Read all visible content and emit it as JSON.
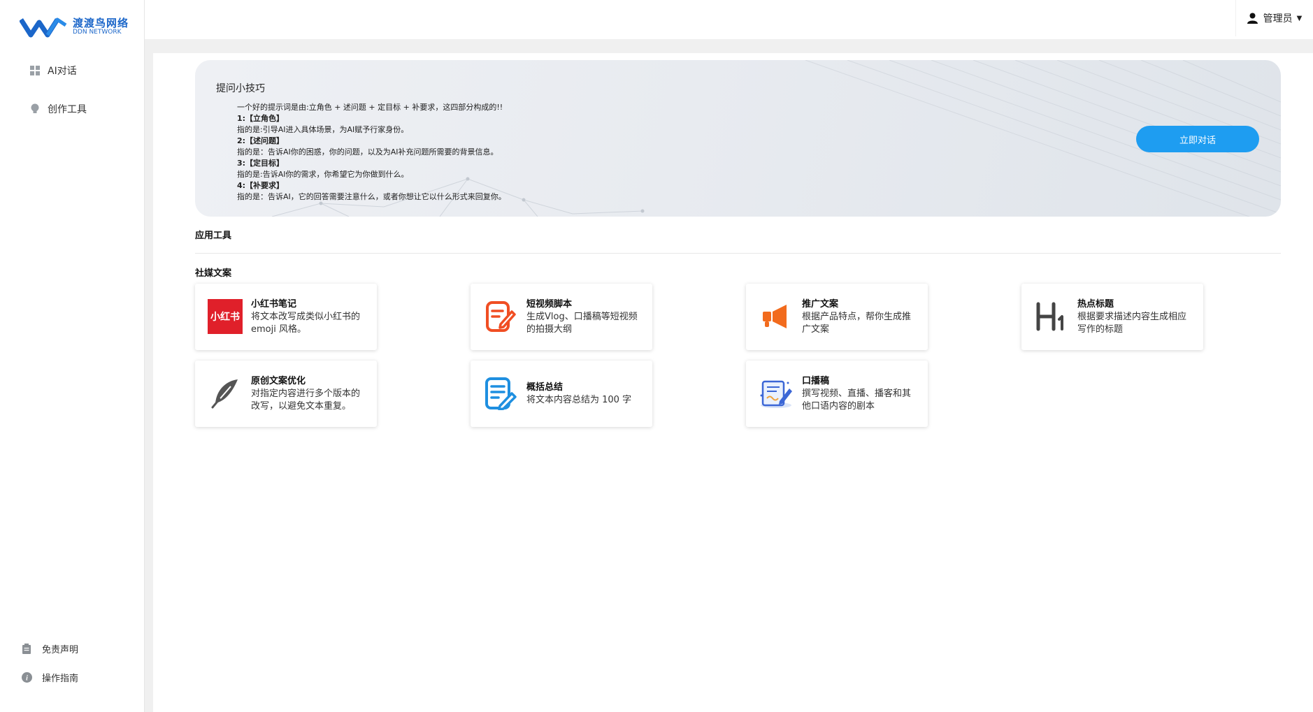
{
  "brand": {
    "name_cn": "渡渡鸟网络",
    "name_en": "DDN NETWORK",
    "color": "#1b66c9"
  },
  "sidebar": {
    "items": [
      {
        "label": "AI对话",
        "icon": "grid-icon"
      },
      {
        "label": "创作工具",
        "icon": "bulb-icon"
      }
    ],
    "footer": [
      {
        "label": "免责声明",
        "icon": "clipboard-icon"
      },
      {
        "label": "操作指南",
        "icon": "info-icon"
      }
    ]
  },
  "header": {
    "user_label": "管理员",
    "user_icon": "user-icon"
  },
  "banner": {
    "title": "提问小技巧",
    "tips": [
      {
        "text": "一个好的提示词是由:立角色 + 述问题 + 定目标 + 补要求，这四部分构成的!!",
        "bold": false
      },
      {
        "text": "1:【立角色】",
        "bold": true
      },
      {
        "text": "指的是:引导AI进入具体场景，为AI赋予行家身份。",
        "bold": false
      },
      {
        "text": "2:【述问题】",
        "bold": true
      },
      {
        "text": "指的是：告诉AI你的困惑，你的问题，以及为AI补充问题所需要的背景信息。",
        "bold": false
      },
      {
        "text": "3:【定目标】",
        "bold": true
      },
      {
        "text": "指的是:告诉AI你的需求，你希望它为你做到什么。",
        "bold": false
      },
      {
        "text": "4:【补要求】",
        "bold": true
      },
      {
        "text": "指的是：告诉AI，它的回答需要注意什么，或者你想让它以什么形式来回复你。",
        "bold": false
      }
    ],
    "button_label": "立即对话",
    "button_color": "#1e9df1"
  },
  "sections": {
    "app_tools": "应用工具",
    "social": "社媒文案"
  },
  "tools": [
    {
      "title": "小红书笔记",
      "desc": "将文本改写成类似小红书的 emoji 风格。",
      "icon": "xiaohongshu-logo",
      "icon_text": "小红书",
      "icon_color": "#e0202a"
    },
    {
      "title": "短视频脚本",
      "desc": "生成Vlog、口播稿等短视频的拍摄大纲",
      "icon": "edit-document-icon",
      "icon_color": "#f04e23"
    },
    {
      "title": "推广文案",
      "desc": "根据产品特点，帮你生成推广文案",
      "icon": "megaphone-icon",
      "icon_color": "#f26b1d"
    },
    {
      "title": "热点标题",
      "desc": "根据要求描述内容生成相应写作的标题",
      "icon": "h1-icon",
      "icon_color": "#444444"
    },
    {
      "title": "原创文案优化",
      "desc": "对指定内容进行多个版本的改写，以避免文本重复。",
      "icon": "feather-icon",
      "icon_color": "#555555"
    },
    {
      "title": "概括总结",
      "desc": "将文本内容总结为 100 字",
      "icon": "summary-note-icon",
      "icon_color": "#1e8fe0"
    },
    {
      "title": "口播稿",
      "desc": "撰写视频、直播、播客和其他口语内容的剧本",
      "icon": "script-board-icon",
      "icon_color": "#3b66d6"
    }
  ]
}
